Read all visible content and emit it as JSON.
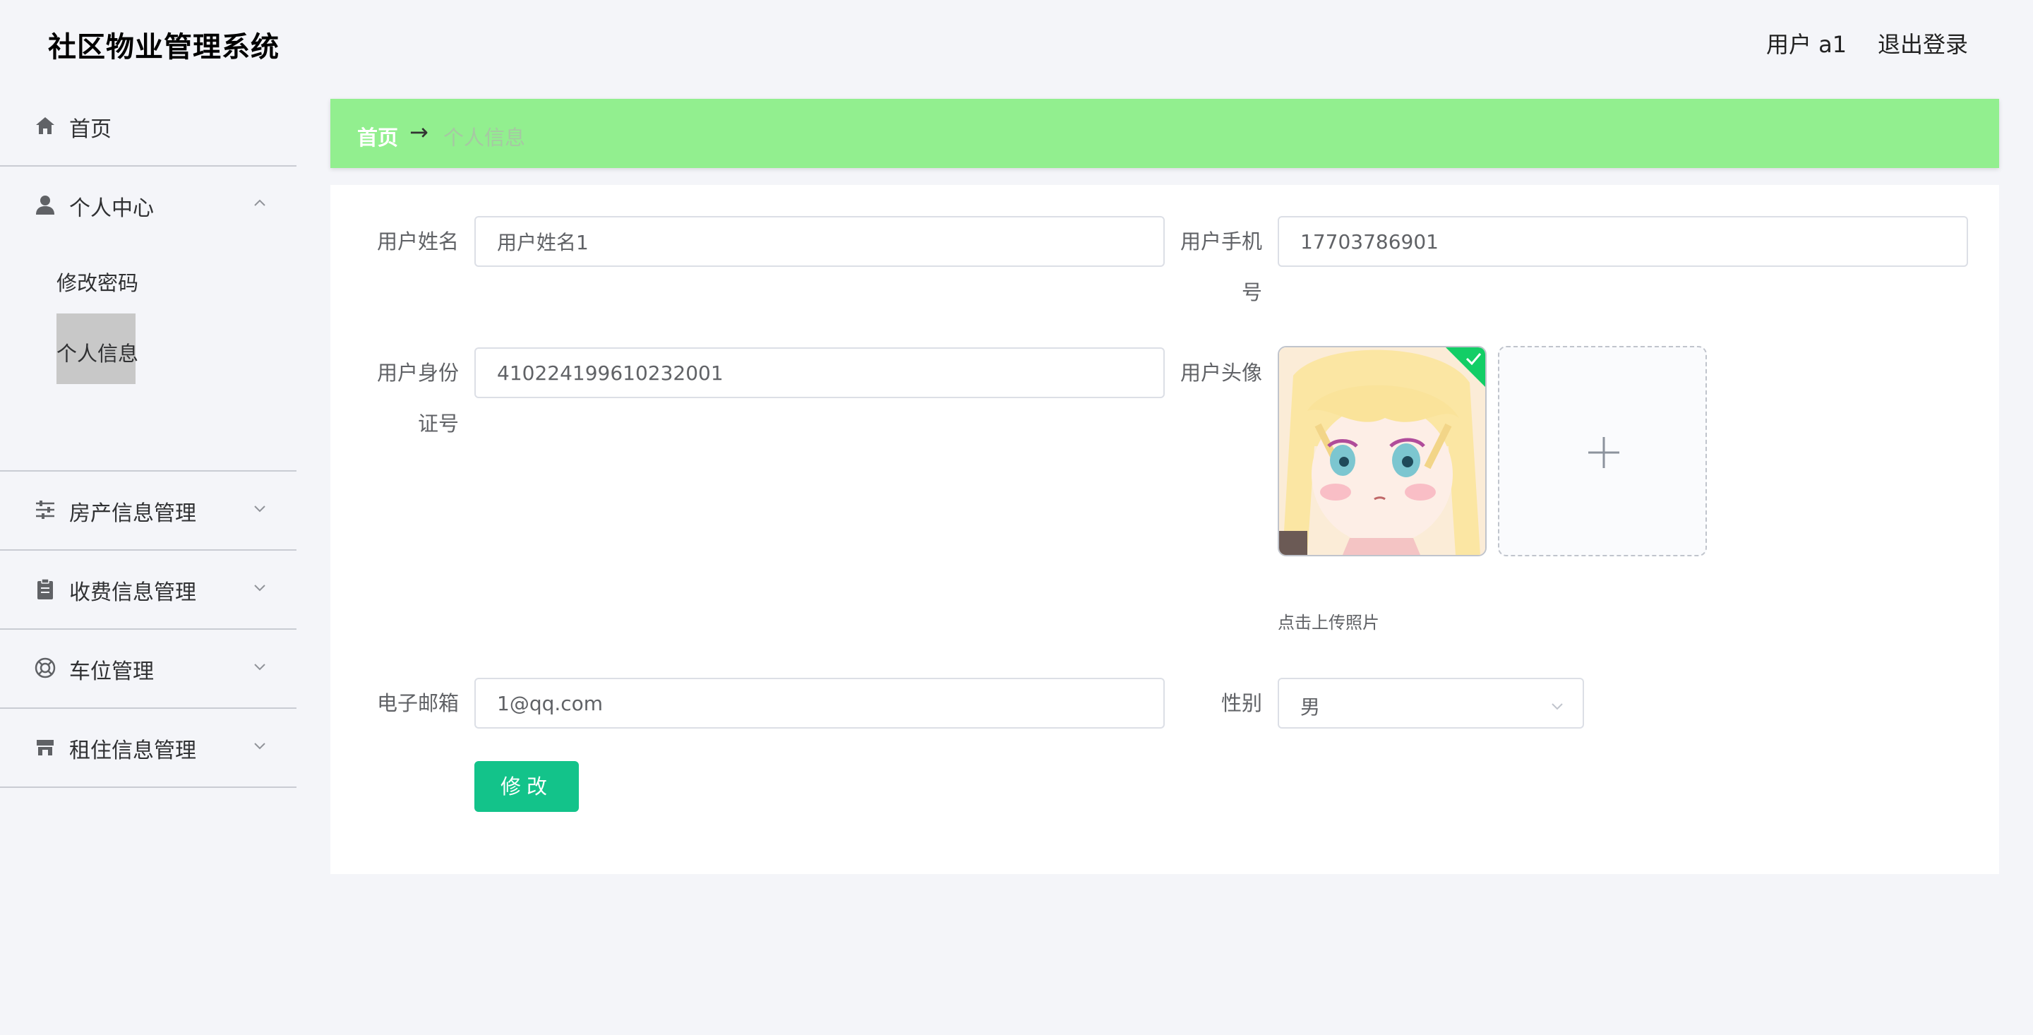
{
  "header": {
    "app_title": "社区物业管理系统",
    "user_label": "用户 a1",
    "logout_label": "退出登录"
  },
  "sidebar": {
    "items": [
      {
        "label": "首页",
        "icon": "home-icon"
      },
      {
        "label": "个人中心",
        "icon": "user-icon",
        "expanded": true,
        "children": [
          {
            "label": "修改密码"
          },
          {
            "label": "个人信息",
            "active": true
          }
        ]
      },
      {
        "label": "房产信息管理",
        "icon": "sliders-icon"
      },
      {
        "label": "收费信息管理",
        "icon": "clipboard-icon"
      },
      {
        "label": "车位管理",
        "icon": "lifebuoy-icon"
      },
      {
        "label": "租住信息管理",
        "icon": "store-icon"
      }
    ]
  },
  "breadcrumb": {
    "home": "首页",
    "separator": "→",
    "current": "个人信息"
  },
  "form": {
    "username": {
      "label": "用户姓名",
      "value": "用户姓名1"
    },
    "phone": {
      "label_line1": "用户手机",
      "label_line2": "号",
      "value": "17703786901"
    },
    "idcard": {
      "label_line1": "用户身份",
      "label_line2": "证号",
      "value": "410224199610232001"
    },
    "avatar": {
      "label": "用户头像",
      "upload_tip": "点击上传照片",
      "plus_icon": "plus-icon",
      "uploaded_icon": "check-icon"
    },
    "email": {
      "label": "电子邮箱",
      "value": "1@qq.com"
    },
    "gender": {
      "label": "性别",
      "value": "男"
    },
    "submit_label": "修改"
  },
  "colors": {
    "breadcrumb_bg": "#92ef8f",
    "primary_button": "#13c38a",
    "upload_success": "#13ce66",
    "page_bg": "#f4f5f9"
  }
}
